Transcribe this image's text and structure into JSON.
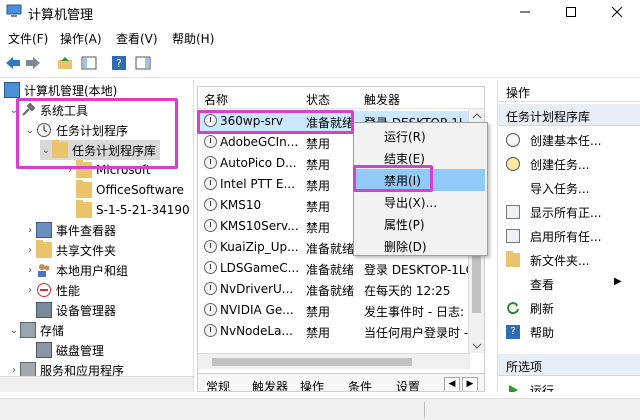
{
  "window": {
    "title": "计算机管理"
  },
  "menu": [
    "文件(F)",
    "操作(A)",
    "查看(V)",
    "帮助(H)"
  ],
  "tree": {
    "root": "计算机管理(本地)",
    "items": [
      {
        "label": "系统工具"
      },
      {
        "label": "任务计划程序"
      },
      {
        "label": "任务计划程序库"
      },
      {
        "label": "Microsoft"
      },
      {
        "label": "OfficeSoftware"
      },
      {
        "label": "S-1-5-21-34190"
      },
      {
        "label": "事件查看器"
      },
      {
        "label": "共享文件夹"
      },
      {
        "label": "本地用户和组"
      },
      {
        "label": "性能"
      },
      {
        "label": "设备管理器"
      },
      {
        "label": "存储"
      },
      {
        "label": "磁盘管理"
      },
      {
        "label": "服务和应用程序"
      }
    ]
  },
  "table": {
    "columns": [
      "名称",
      "状态",
      "触发器"
    ],
    "rows": [
      {
        "name": "360wp-srv",
        "status": "准备就绪",
        "trigger": "登录 DESKTOP-1L"
      },
      {
        "name": "AdobeGCIn...",
        "status": "禁用",
        "trigger": ""
      },
      {
        "name": "AutoPico D...",
        "status": "禁用",
        "trigger": ""
      },
      {
        "name": "Intel PTT E...",
        "status": "禁用",
        "trigger": ""
      },
      {
        "name": "KMS10",
        "status": "禁用",
        "trigger": ""
      },
      {
        "name": "KMS10Serv...",
        "status": "禁用",
        "trigger": ""
      },
      {
        "name": "KuaiZip_Up...",
        "status": "准备就绪",
        "trigger": ""
      },
      {
        "name": "LDSGameC...",
        "status": "准备就绪",
        "trigger": "登录 DESKTOP-1LC"
      },
      {
        "name": "NvDriverU...",
        "status": "准备就绪",
        "trigger": "在每天的 12:25"
      },
      {
        "name": "NVIDIA Ge...",
        "status": "禁用",
        "trigger": "发生事件时 - 日志:"
      },
      {
        "name": "NvNodeLa...",
        "status": "禁用",
        "trigger": "当任何用户登录时 -"
      }
    ],
    "tabs": [
      "常规",
      "触发器",
      "操作",
      "条件",
      "设置"
    ]
  },
  "context_menu": [
    "运行(R)",
    "结束(E)",
    "禁用(I)",
    "导出(X)...",
    "属性(P)",
    "删除(D)"
  ],
  "actions": {
    "header": "操作",
    "section1": "任务计划程序库",
    "items1": [
      "创建基本任...",
      "创建任务...",
      "导入任务...",
      "显示所有正...",
      "启用所有任...",
      "新文件夹...",
      "查看",
      "刷新",
      "帮助"
    ],
    "section2": "所选项",
    "items2": [
      "运行"
    ]
  },
  "colors": {
    "highlight": "#d63fd0",
    "selected": "#cce8ff",
    "menu_highlight": "#91c9f7"
  }
}
